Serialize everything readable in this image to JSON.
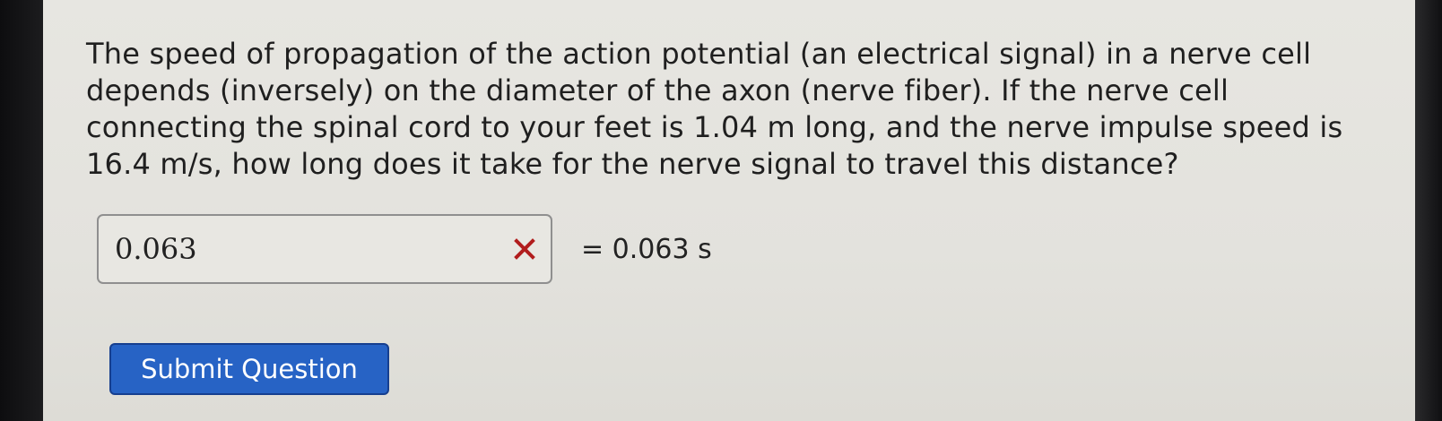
{
  "question": {
    "text": "The speed of propagation of the action potential (an electrical signal) in a nerve cell depends (inversely) on the diameter of the axon (nerve fiber). If the nerve cell connecting the spinal cord to your feet is 1.04 m long, and the nerve impulse speed is 16.4 m/s, how long does it take for the nerve signal to travel this distance?"
  },
  "answer": {
    "input_value": "0.063",
    "status_icon": "x-icon",
    "status": "incorrect",
    "status_color": "#b11d1d",
    "result": "= 0.063 s"
  },
  "submit": {
    "label": "Submit Question",
    "color": "#2763c5"
  }
}
